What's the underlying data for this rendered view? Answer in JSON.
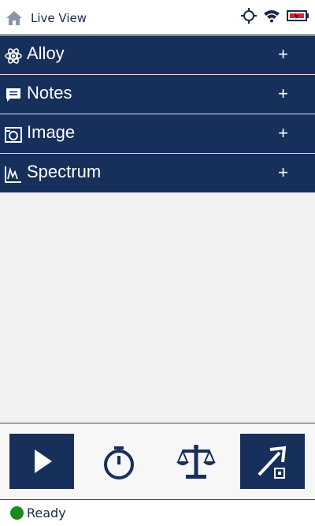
{
  "header": {
    "title": "Live View",
    "icons": [
      "home-icon",
      "crosshair-icon",
      "wifi-icon",
      "battery-charging-icon"
    ]
  },
  "panels": [
    {
      "label": "Alloy",
      "icon": "atom-icon",
      "action": "+"
    },
    {
      "label": "Notes",
      "icon": "comment-icon",
      "action": "+"
    },
    {
      "label": "Image",
      "icon": "camera-icon",
      "action": "+"
    },
    {
      "label": "Spectrum",
      "icon": "spectrum-chart-icon",
      "action": "+"
    }
  ],
  "toolbar": {
    "buttons": [
      "play-icon",
      "stopwatch-icon",
      "scale-balance-icon",
      "export-usb-icon"
    ]
  },
  "status": {
    "text": "Ready",
    "color": "#1a8a1a"
  },
  "colors": {
    "panel_bg": "#172f5b",
    "accent_text": "#1a2a4a",
    "battery_warning": "#d9262c"
  }
}
